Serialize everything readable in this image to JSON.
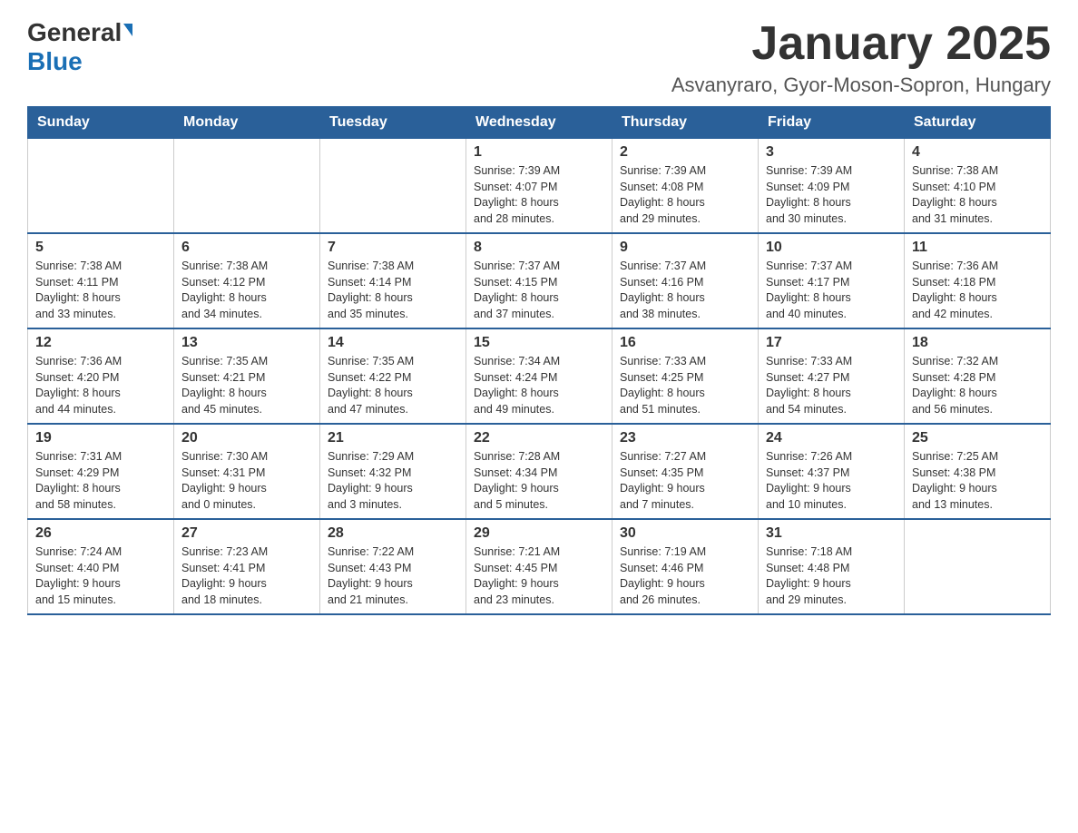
{
  "header": {
    "logo_general": "General",
    "logo_blue": "Blue",
    "month_year": "January 2025",
    "location": "Asvanyraro, Gyor-Moson-Sopron, Hungary"
  },
  "days_of_week": [
    "Sunday",
    "Monday",
    "Tuesday",
    "Wednesday",
    "Thursday",
    "Friday",
    "Saturday"
  ],
  "weeks": [
    [
      {
        "day": "",
        "info": ""
      },
      {
        "day": "",
        "info": ""
      },
      {
        "day": "",
        "info": ""
      },
      {
        "day": "1",
        "info": "Sunrise: 7:39 AM\nSunset: 4:07 PM\nDaylight: 8 hours\nand 28 minutes."
      },
      {
        "day": "2",
        "info": "Sunrise: 7:39 AM\nSunset: 4:08 PM\nDaylight: 8 hours\nand 29 minutes."
      },
      {
        "day": "3",
        "info": "Sunrise: 7:39 AM\nSunset: 4:09 PM\nDaylight: 8 hours\nand 30 minutes."
      },
      {
        "day": "4",
        "info": "Sunrise: 7:38 AM\nSunset: 4:10 PM\nDaylight: 8 hours\nand 31 minutes."
      }
    ],
    [
      {
        "day": "5",
        "info": "Sunrise: 7:38 AM\nSunset: 4:11 PM\nDaylight: 8 hours\nand 33 minutes."
      },
      {
        "day": "6",
        "info": "Sunrise: 7:38 AM\nSunset: 4:12 PM\nDaylight: 8 hours\nand 34 minutes."
      },
      {
        "day": "7",
        "info": "Sunrise: 7:38 AM\nSunset: 4:14 PM\nDaylight: 8 hours\nand 35 minutes."
      },
      {
        "day": "8",
        "info": "Sunrise: 7:37 AM\nSunset: 4:15 PM\nDaylight: 8 hours\nand 37 minutes."
      },
      {
        "day": "9",
        "info": "Sunrise: 7:37 AM\nSunset: 4:16 PM\nDaylight: 8 hours\nand 38 minutes."
      },
      {
        "day": "10",
        "info": "Sunrise: 7:37 AM\nSunset: 4:17 PM\nDaylight: 8 hours\nand 40 minutes."
      },
      {
        "day": "11",
        "info": "Sunrise: 7:36 AM\nSunset: 4:18 PM\nDaylight: 8 hours\nand 42 minutes."
      }
    ],
    [
      {
        "day": "12",
        "info": "Sunrise: 7:36 AM\nSunset: 4:20 PM\nDaylight: 8 hours\nand 44 minutes."
      },
      {
        "day": "13",
        "info": "Sunrise: 7:35 AM\nSunset: 4:21 PM\nDaylight: 8 hours\nand 45 minutes."
      },
      {
        "day": "14",
        "info": "Sunrise: 7:35 AM\nSunset: 4:22 PM\nDaylight: 8 hours\nand 47 minutes."
      },
      {
        "day": "15",
        "info": "Sunrise: 7:34 AM\nSunset: 4:24 PM\nDaylight: 8 hours\nand 49 minutes."
      },
      {
        "day": "16",
        "info": "Sunrise: 7:33 AM\nSunset: 4:25 PM\nDaylight: 8 hours\nand 51 minutes."
      },
      {
        "day": "17",
        "info": "Sunrise: 7:33 AM\nSunset: 4:27 PM\nDaylight: 8 hours\nand 54 minutes."
      },
      {
        "day": "18",
        "info": "Sunrise: 7:32 AM\nSunset: 4:28 PM\nDaylight: 8 hours\nand 56 minutes."
      }
    ],
    [
      {
        "day": "19",
        "info": "Sunrise: 7:31 AM\nSunset: 4:29 PM\nDaylight: 8 hours\nand 58 minutes."
      },
      {
        "day": "20",
        "info": "Sunrise: 7:30 AM\nSunset: 4:31 PM\nDaylight: 9 hours\nand 0 minutes."
      },
      {
        "day": "21",
        "info": "Sunrise: 7:29 AM\nSunset: 4:32 PM\nDaylight: 9 hours\nand 3 minutes."
      },
      {
        "day": "22",
        "info": "Sunrise: 7:28 AM\nSunset: 4:34 PM\nDaylight: 9 hours\nand 5 minutes."
      },
      {
        "day": "23",
        "info": "Sunrise: 7:27 AM\nSunset: 4:35 PM\nDaylight: 9 hours\nand 7 minutes."
      },
      {
        "day": "24",
        "info": "Sunrise: 7:26 AM\nSunset: 4:37 PM\nDaylight: 9 hours\nand 10 minutes."
      },
      {
        "day": "25",
        "info": "Sunrise: 7:25 AM\nSunset: 4:38 PM\nDaylight: 9 hours\nand 13 minutes."
      }
    ],
    [
      {
        "day": "26",
        "info": "Sunrise: 7:24 AM\nSunset: 4:40 PM\nDaylight: 9 hours\nand 15 minutes."
      },
      {
        "day": "27",
        "info": "Sunrise: 7:23 AM\nSunset: 4:41 PM\nDaylight: 9 hours\nand 18 minutes."
      },
      {
        "day": "28",
        "info": "Sunrise: 7:22 AM\nSunset: 4:43 PM\nDaylight: 9 hours\nand 21 minutes."
      },
      {
        "day": "29",
        "info": "Sunrise: 7:21 AM\nSunset: 4:45 PM\nDaylight: 9 hours\nand 23 minutes."
      },
      {
        "day": "30",
        "info": "Sunrise: 7:19 AM\nSunset: 4:46 PM\nDaylight: 9 hours\nand 26 minutes."
      },
      {
        "day": "31",
        "info": "Sunrise: 7:18 AM\nSunset: 4:48 PM\nDaylight: 9 hours\nand 29 minutes."
      },
      {
        "day": "",
        "info": ""
      }
    ]
  ]
}
